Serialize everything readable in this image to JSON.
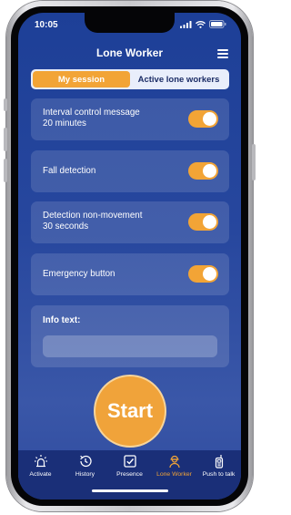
{
  "status_bar": {
    "time": "10:05",
    "icons": [
      "signal-icon",
      "wifi-icon",
      "battery-icon"
    ]
  },
  "header": {
    "title": "Lone Worker",
    "menu_icon": "hamburger-menu-icon"
  },
  "segments": {
    "my_session": "My session",
    "active_lone_workers": "Active lone workers",
    "selected": "My session"
  },
  "settings": {
    "interval": {
      "line1": "Interval control message",
      "line2": "20 minutes",
      "enabled": true
    },
    "fall_detection": {
      "label": "Fall detection",
      "enabled": true
    },
    "non_movement": {
      "line1": "Detection non-movement",
      "line2": "30 seconds",
      "enabled": true
    },
    "emergency_button": {
      "label": "Emergency button",
      "enabled": true
    }
  },
  "info": {
    "label": "Info text:",
    "value": ""
  },
  "start_button": {
    "label": "Start"
  },
  "tabbar": {
    "items": [
      {
        "label": "Activate",
        "icon": "alarm-light-icon"
      },
      {
        "label": "History",
        "icon": "history-clock-icon"
      },
      {
        "label": "Presence",
        "icon": "checkbox-icon"
      },
      {
        "label": "Lone Worker",
        "icon": "worker-icon"
      },
      {
        "label": "Push to talk",
        "icon": "walkie-talkie-icon"
      }
    ],
    "active": "Lone Worker"
  },
  "colors": {
    "accent": "#f2a436",
    "background_top": "#1d3f97",
    "background_bottom": "#3a57a8",
    "tabbar": "#1a2f78"
  }
}
